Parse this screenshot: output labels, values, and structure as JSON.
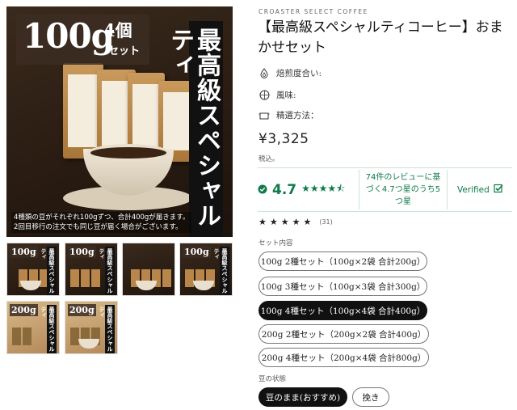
{
  "gallery": {
    "hero": {
      "badge_main": "100g",
      "badge_count": "4個",
      "badge_set": "セット",
      "vertical_text": "最高級スペシャルティ",
      "note_line1": "4種類の豆がそれぞれ100gずつ、合計400gが届きます。",
      "note_line2": "2回目移行の注文でも同じ豆が届く場合がございます。"
    },
    "thumbs": [
      {
        "badge": "100g",
        "vtext": "最高級スペシャルティ"
      },
      {
        "badge": "100g",
        "vtext": "最高級スペシャルティ"
      },
      {
        "badge": "",
        "vtext": ""
      },
      {
        "badge": "100g",
        "vtext": "最高級スペシャルティ"
      },
      {
        "badge": "200g",
        "vtext": "最高級スペシャルティ"
      },
      {
        "badge": "200g",
        "vtext": "最高級スペシャルティ"
      }
    ]
  },
  "product": {
    "brand": "CROASTER SELECT COFFEE",
    "title": "【最高級スペシャルティコーヒー】おまかせセット",
    "attributes": [
      {
        "icon": "flame-icon",
        "label": "焙煎度合い:"
      },
      {
        "icon": "taste-icon",
        "label": "風味:"
      },
      {
        "icon": "process-icon",
        "label": "精選方法："
      }
    ],
    "price": "¥3,325",
    "tax_note": "税込。"
  },
  "reviews": {
    "score": "4.7",
    "stars": "★★★★⯪",
    "summary": "74件のレビューに基づく4.7つ星のうち5つ星",
    "verified": "Verified",
    "row_stars": "★★★★★",
    "row_count": "(31)"
  },
  "options": {
    "set_label": "セット内容",
    "sets": [
      "100g 2種セット（100g×2袋 合計200g）",
      "100g 3種セット（100g×3袋 合計300g）",
      "100g 4種セット（100g×4袋 合計400g）",
      "200g 2種セット（200g×2袋 合計400g）",
      "200g 4種セット（200g×4袋 合計800g）"
    ],
    "selected_set": 2,
    "bean_label": "豆の状態",
    "beans": [
      "豆のまま(おすすめ)",
      "挽き"
    ],
    "selected_bean": 0
  },
  "colors": {
    "accent_green": "#0f7a4a",
    "selected_bg": "#111111"
  }
}
